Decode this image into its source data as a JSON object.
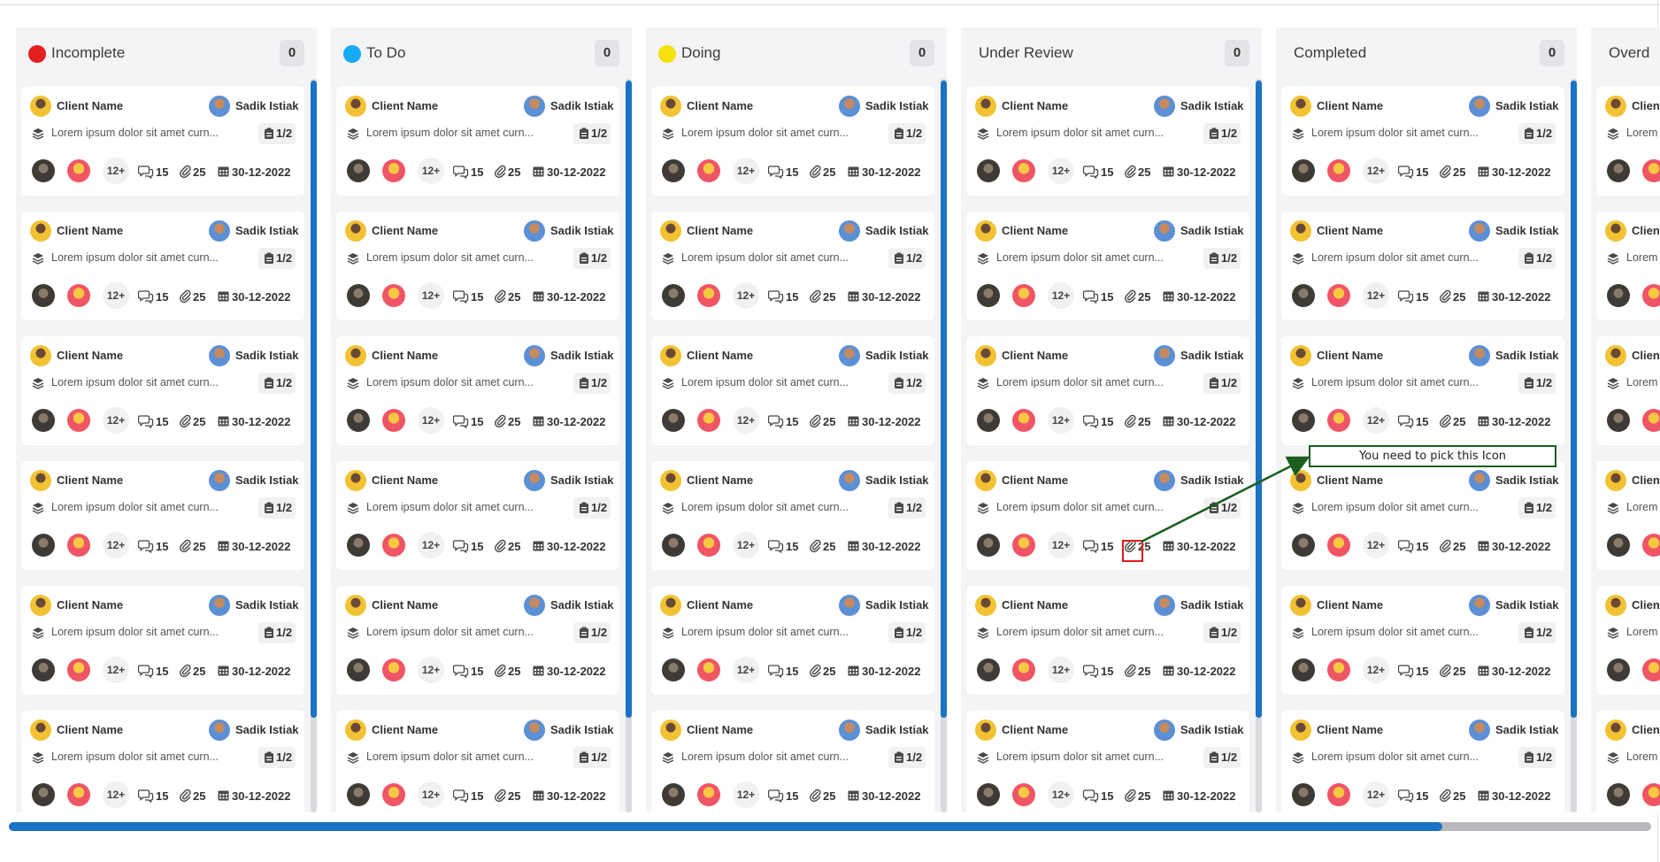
{
  "columns": [
    {
      "title": "Incomplete",
      "count": "0",
      "color": "#e41f1f"
    },
    {
      "title": "To Do",
      "count": "0",
      "color": "#15aaf3"
    },
    {
      "title": "Doing",
      "count": "0",
      "color": "#f5e10c"
    },
    {
      "title": "Under Review",
      "count": "0",
      "color": ""
    },
    {
      "title": "Completed",
      "count": "0",
      "color": ""
    },
    {
      "title": "Overd",
      "count": "",
      "color": ""
    }
  ],
  "card": {
    "client_name": "Client Name",
    "assignee_name": "Sadik Istiak",
    "description": "Lorem ipsum dolor sit amet curn...",
    "subtasks": "1/2",
    "more_members": "12+",
    "comments": "15",
    "attachments": "25",
    "date": "30-12-2022"
  },
  "annotation": {
    "text": "You need to pick this Icon",
    "box_color": "#e21b1b",
    "arrow_color": "#1b5e20"
  },
  "icons": {
    "layers": "layers-icon",
    "subtasks": "clipboard-icon",
    "comments": "chat-icon",
    "attachments": "paperclip-icon",
    "date": "calendar-icon"
  },
  "accent_color": "#1a73c4"
}
